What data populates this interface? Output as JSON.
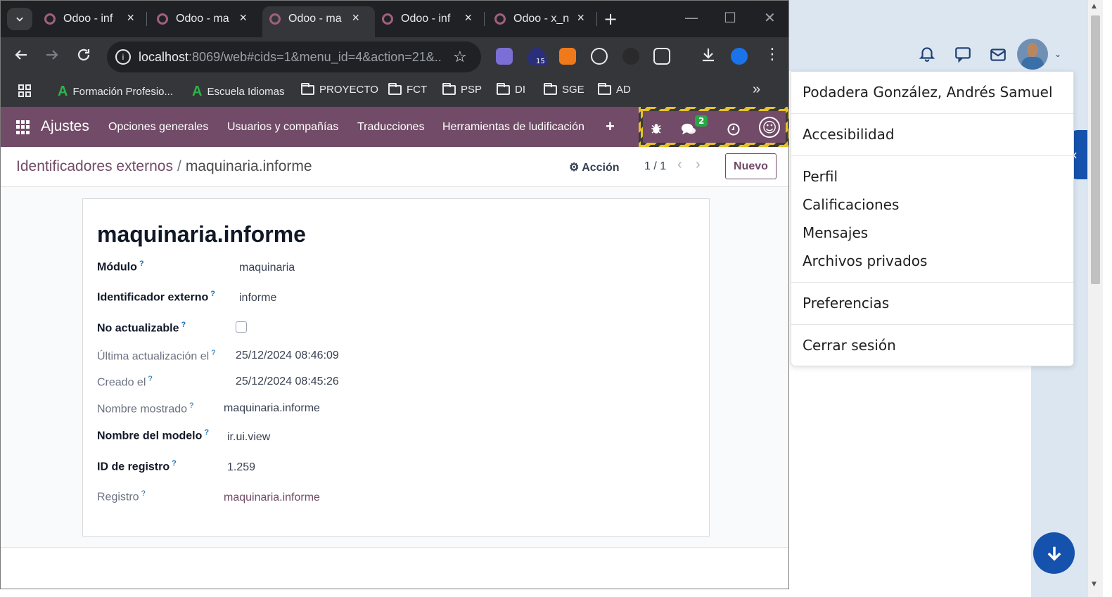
{
  "browser": {
    "tabs": [
      {
        "title": "Odoo - inf",
        "active": false
      },
      {
        "title": "Odoo - ma",
        "active": false
      },
      {
        "title": "Odoo - ma",
        "active": true
      },
      {
        "title": "Odoo - inf",
        "active": false
      },
      {
        "title": "Odoo - x_n",
        "active": false
      }
    ],
    "url_host": "localhost",
    "url_path": ":8069/web#cids=1&menu_id=4&action=21&...",
    "extension_badge": "15",
    "bookmarks": [
      {
        "label": "Formación Profesio...",
        "icon": "green-a-icon"
      },
      {
        "label": "Escuela Idiomas",
        "icon": "green-a-icon"
      },
      {
        "label": "PROYECTO",
        "icon": "folder-icon"
      },
      {
        "label": "FCT",
        "icon": "folder-icon"
      },
      {
        "label": "PSP",
        "icon": "folder-icon"
      },
      {
        "label": "DI",
        "icon": "folder-icon"
      },
      {
        "label": "SGE",
        "icon": "folder-icon"
      },
      {
        "label": "AD",
        "icon": "folder-icon"
      }
    ]
  },
  "odoo": {
    "app_name": "Ajustes",
    "menu": [
      "Opciones generales",
      "Usuarios y compañías",
      "Traducciones",
      "Herramientas de ludificación"
    ],
    "chat_badge": "2",
    "breadcrumb": {
      "parent": "Identificadores externos",
      "separator": "/",
      "current": "maquinaria.informe"
    },
    "action_label": "Acción",
    "pager": "1 / 1",
    "new_label": "Nuevo",
    "record": {
      "title": "maquinaria.informe",
      "fields": {
        "module": {
          "label": "Módulo",
          "value": "maquinaria"
        },
        "external_id": {
          "label": "Identificador externo",
          "value": "informe"
        },
        "noupdate": {
          "label": "No actualizable",
          "checked": false
        },
        "write_date": {
          "label": "Última actualización el",
          "value": "25/12/2024 08:46:09"
        },
        "create_date": {
          "label": "Creado el",
          "value": "25/12/2024 08:45:26"
        },
        "display_name": {
          "label": "Nombre mostrado",
          "value": "maquinaria.informe"
        },
        "model": {
          "label": "Nombre del modelo",
          "value": "ir.ui.view"
        },
        "res_id": {
          "label": "ID de registro",
          "value": "1.259"
        },
        "reference": {
          "label": "Registro",
          "value": "maquinaria.informe"
        }
      },
      "help_marker": "?"
    }
  },
  "user_menu": {
    "name": "Podadera González, Andrés Samuel",
    "accessibility": "Accesibilidad",
    "items": [
      "Perfil",
      "Calificaciones",
      "Mensajes",
      "Archivos privados"
    ],
    "preferences": "Preferencias",
    "logout": "Cerrar sesión"
  },
  "colors": {
    "odoo_primary": "#714b67",
    "background_app_blue": "#1552ad",
    "chrome_dark": "#202124"
  }
}
